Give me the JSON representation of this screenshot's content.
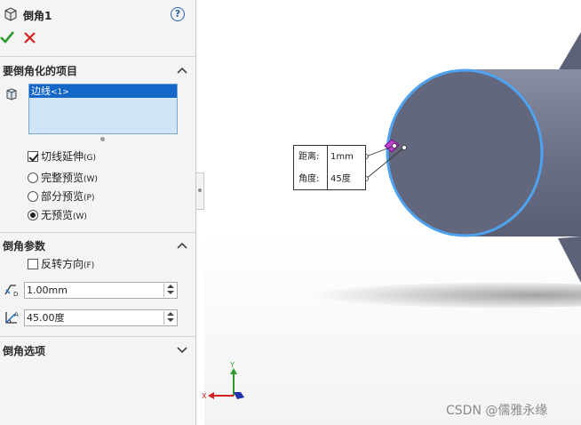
{
  "feature": {
    "title": "倒角1",
    "help_symbol": "?"
  },
  "actions": {
    "ok_icon": "check-icon",
    "cancel_icon": "close-icon"
  },
  "items_section": {
    "title": "要倒角化的项目",
    "selected_item": {
      "label": "边线",
      "count": "<1>"
    }
  },
  "edge_options": [
    {
      "label": "切线延伸",
      "shortcut": "(G)",
      "type": "checkbox",
      "checked": true
    },
    {
      "label": "完整预览",
      "shortcut": "(W)",
      "type": "radio",
      "checked": false
    },
    {
      "label": "部分预览",
      "shortcut": "(P)",
      "type": "radio",
      "checked": false
    },
    {
      "label": "无预览",
      "shortcut": "(W)",
      "type": "radio",
      "checked": true
    }
  ],
  "params_section": {
    "title": "倒角参数",
    "reverse": {
      "label": "反转方向",
      "shortcut": "(F)",
      "checked": false
    },
    "distance_value": "1.00mm",
    "angle_value": "45.00度"
  },
  "options_section": {
    "title": "倒角选项"
  },
  "callout": {
    "distance_label": "距离:",
    "distance_value": "1mm",
    "angle_label": "角度:",
    "angle_value": "45度"
  },
  "triad": {
    "x_label": "X",
    "y_label": "Y"
  },
  "watermark": "CSDN @儒雅永缘",
  "colors": {
    "selection": "#1466c8",
    "edge_highlight": "#4da3f0",
    "cylinder": "#6b7088",
    "ok": "#2e9a2e",
    "cancel": "#d42020"
  }
}
